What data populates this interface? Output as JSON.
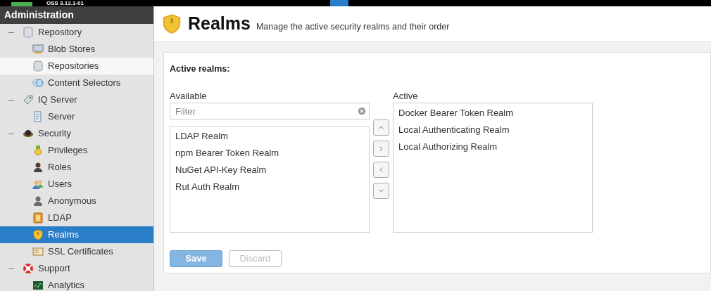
{
  "top_bar": {
    "version": "OSS 3.12.1-01"
  },
  "sidebar": {
    "title": "Administration",
    "items": [
      {
        "label": "Repository",
        "expanded": true,
        "selected": false,
        "hovered": false,
        "children": [
          {
            "label": "Blob Stores",
            "selected": false,
            "hovered": false
          },
          {
            "label": "Repositories",
            "selected": false,
            "hovered": true
          },
          {
            "label": "Content Selectors",
            "selected": false,
            "hovered": false
          }
        ]
      },
      {
        "label": "IQ Server",
        "expanded": true,
        "selected": false,
        "hovered": false,
        "children": [
          {
            "label": "Server",
            "selected": false,
            "hovered": false
          }
        ]
      },
      {
        "label": "Security",
        "expanded": true,
        "selected": false,
        "hovered": false,
        "children": [
          {
            "label": "Privileges",
            "selected": false,
            "hovered": false
          },
          {
            "label": "Roles",
            "selected": false,
            "hovered": false
          },
          {
            "label": "Users",
            "selected": false,
            "hovered": false
          },
          {
            "label": "Anonymous",
            "selected": false,
            "hovered": false
          },
          {
            "label": "LDAP",
            "selected": false,
            "hovered": false
          },
          {
            "label": "Realms",
            "selected": true,
            "hovered": false
          },
          {
            "label": "SSL Certificates",
            "selected": false,
            "hovered": false
          }
        ]
      },
      {
        "label": "Support",
        "expanded": true,
        "selected": false,
        "hovered": false,
        "children": [
          {
            "label": "Analytics",
            "selected": false,
            "hovered": false
          }
        ]
      }
    ]
  },
  "header": {
    "title": "Realms",
    "subtitle": "Manage the active security realms and their order"
  },
  "form": {
    "section_title": "Active realms:",
    "available": {
      "label": "Available",
      "filter_placeholder": "Filter",
      "items": [
        "LDAP Realm",
        "npm Bearer Token Realm",
        "NuGet API-Key Realm",
        "Rut Auth Realm"
      ]
    },
    "active": {
      "label": "Active",
      "items": [
        "Docker Bearer Token Realm",
        "Local Authenticating Realm",
        "Local Authorizing Realm"
      ]
    },
    "buttons": [
      {
        "label": "Save",
        "kind": "primary",
        "disabled": true
      },
      {
        "label": "Discard",
        "kind": "secondary",
        "disabled": true
      }
    ]
  }
}
